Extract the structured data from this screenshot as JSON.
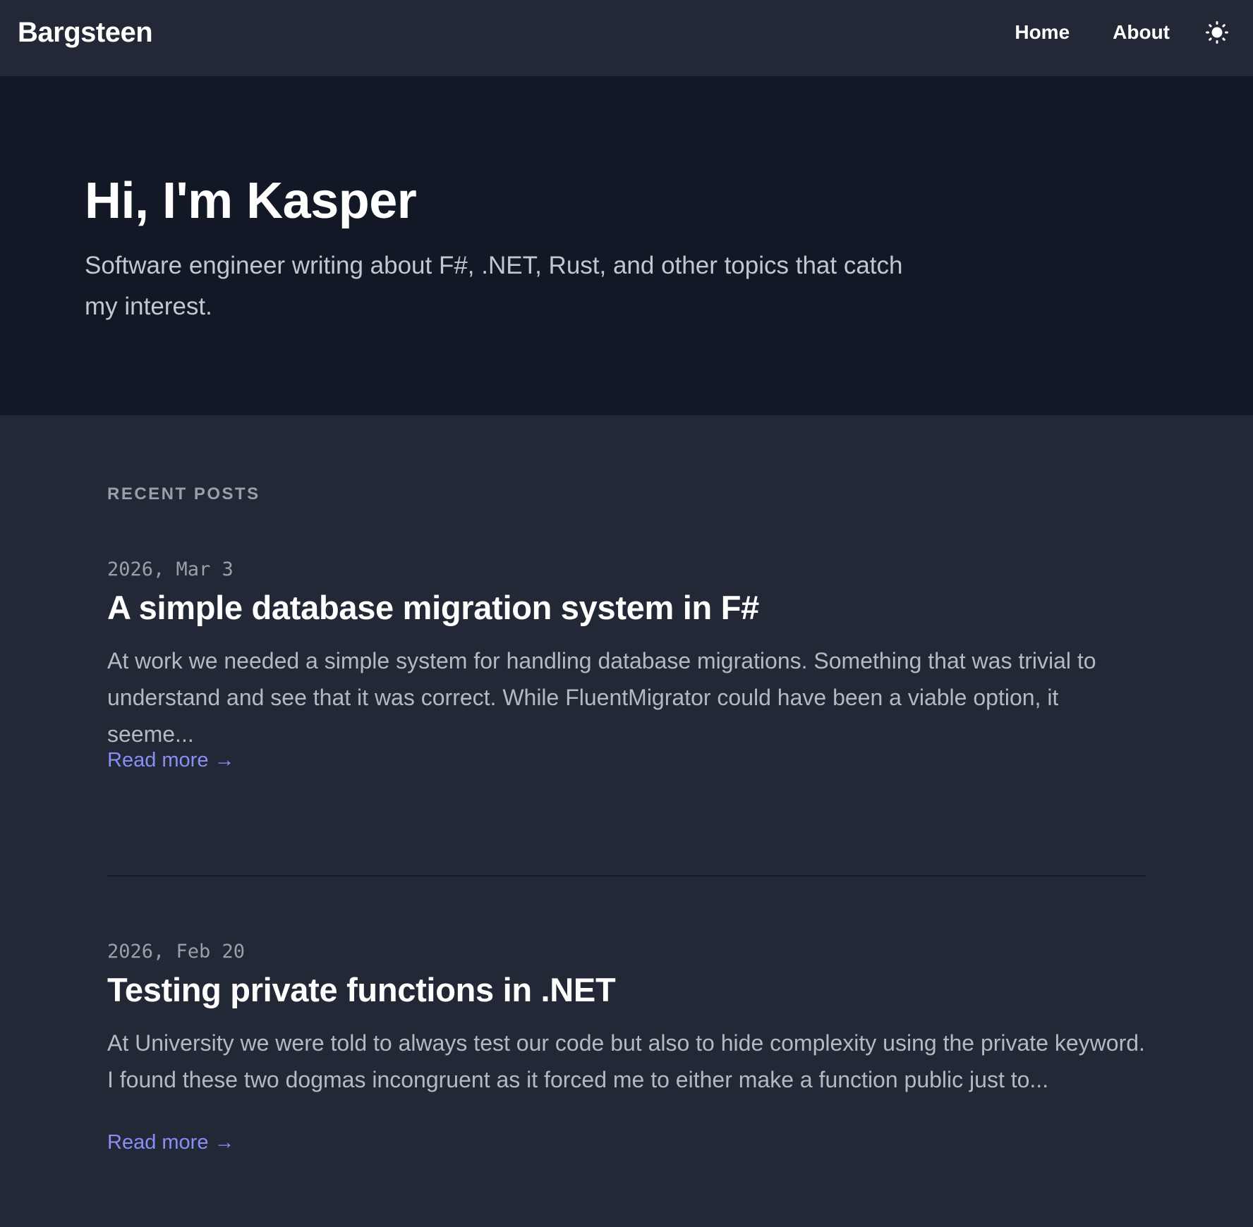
{
  "header": {
    "brand": "Bargsteen",
    "nav": [
      {
        "label": "Home"
      },
      {
        "label": "About"
      }
    ],
    "theme_toggle_icon": "sun-icon"
  },
  "hero": {
    "title": "Hi, I'm Kasper",
    "subtitle": "Software engineer writing about F#, .NET, Rust, and other topics that catch my interest."
  },
  "recent_posts": {
    "heading": "RECENT POSTS",
    "posts": [
      {
        "date": "2026, Mar 3",
        "title": "A simple database migration system in F#",
        "excerpt": "At work we needed a simple system for handling database migrations. Something that was trivial to understand and see that it was correct. While FluentMigrator could have been a viable option, it seeme...",
        "read_more": "Read more →"
      },
      {
        "date": "2026, Feb 20",
        "title": "Testing private functions in .NET",
        "excerpt": "At University we were told to always test our code but also to hide complexity using the private keyword. I found these two dogmas incongruent as it forced me to either make a function public just to...",
        "read_more": "Read more →"
      }
    ]
  },
  "colors": {
    "page_background": "#222836",
    "hero_background": "#121826",
    "link_accent": "#8b8ff5",
    "muted_text": "#9aa0ab"
  }
}
